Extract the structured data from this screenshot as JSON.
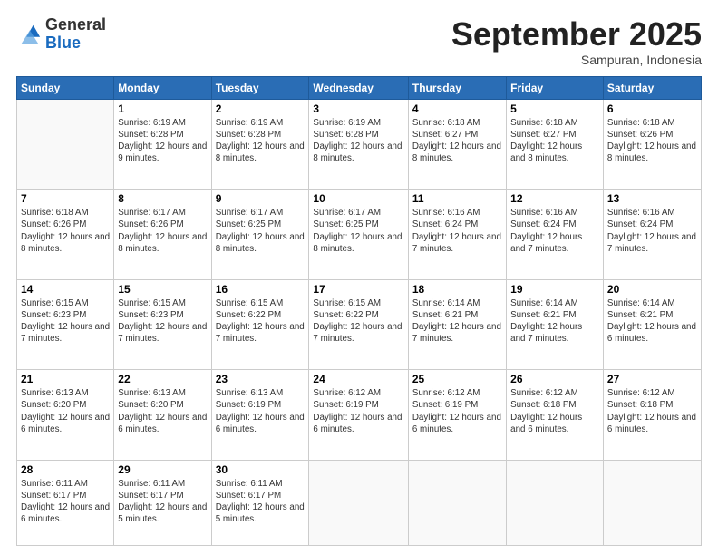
{
  "logo": {
    "general": "General",
    "blue": "Blue"
  },
  "title": "September 2025",
  "subtitle": "Sampuran, Indonesia",
  "days": [
    "Sunday",
    "Monday",
    "Tuesday",
    "Wednesday",
    "Thursday",
    "Friday",
    "Saturday"
  ],
  "weeks": [
    [
      {
        "num": "",
        "empty": true
      },
      {
        "num": "1",
        "sunrise": "6:19 AM",
        "sunset": "6:28 PM",
        "daylight": "12 hours and 9 minutes."
      },
      {
        "num": "2",
        "sunrise": "6:19 AM",
        "sunset": "6:28 PM",
        "daylight": "12 hours and 8 minutes."
      },
      {
        "num": "3",
        "sunrise": "6:19 AM",
        "sunset": "6:28 PM",
        "daylight": "12 hours and 8 minutes."
      },
      {
        "num": "4",
        "sunrise": "6:18 AM",
        "sunset": "6:27 PM",
        "daylight": "12 hours and 8 minutes."
      },
      {
        "num": "5",
        "sunrise": "6:18 AM",
        "sunset": "6:27 PM",
        "daylight": "12 hours and 8 minutes."
      },
      {
        "num": "6",
        "sunrise": "6:18 AM",
        "sunset": "6:26 PM",
        "daylight": "12 hours and 8 minutes."
      }
    ],
    [
      {
        "num": "7",
        "sunrise": "6:18 AM",
        "sunset": "6:26 PM",
        "daylight": "12 hours and 8 minutes."
      },
      {
        "num": "8",
        "sunrise": "6:17 AM",
        "sunset": "6:26 PM",
        "daylight": "12 hours and 8 minutes."
      },
      {
        "num": "9",
        "sunrise": "6:17 AM",
        "sunset": "6:25 PM",
        "daylight": "12 hours and 8 minutes."
      },
      {
        "num": "10",
        "sunrise": "6:17 AM",
        "sunset": "6:25 PM",
        "daylight": "12 hours and 8 minutes."
      },
      {
        "num": "11",
        "sunrise": "6:16 AM",
        "sunset": "6:24 PM",
        "daylight": "12 hours and 7 minutes."
      },
      {
        "num": "12",
        "sunrise": "6:16 AM",
        "sunset": "6:24 PM",
        "daylight": "12 hours and 7 minutes."
      },
      {
        "num": "13",
        "sunrise": "6:16 AM",
        "sunset": "6:24 PM",
        "daylight": "12 hours and 7 minutes."
      }
    ],
    [
      {
        "num": "14",
        "sunrise": "6:15 AM",
        "sunset": "6:23 PM",
        "daylight": "12 hours and 7 minutes."
      },
      {
        "num": "15",
        "sunrise": "6:15 AM",
        "sunset": "6:23 PM",
        "daylight": "12 hours and 7 minutes."
      },
      {
        "num": "16",
        "sunrise": "6:15 AM",
        "sunset": "6:22 PM",
        "daylight": "12 hours and 7 minutes."
      },
      {
        "num": "17",
        "sunrise": "6:15 AM",
        "sunset": "6:22 PM",
        "daylight": "12 hours and 7 minutes."
      },
      {
        "num": "18",
        "sunrise": "6:14 AM",
        "sunset": "6:21 PM",
        "daylight": "12 hours and 7 minutes."
      },
      {
        "num": "19",
        "sunrise": "6:14 AM",
        "sunset": "6:21 PM",
        "daylight": "12 hours and 7 minutes."
      },
      {
        "num": "20",
        "sunrise": "6:14 AM",
        "sunset": "6:21 PM",
        "daylight": "12 hours and 6 minutes."
      }
    ],
    [
      {
        "num": "21",
        "sunrise": "6:13 AM",
        "sunset": "6:20 PM",
        "daylight": "12 hours and 6 minutes."
      },
      {
        "num": "22",
        "sunrise": "6:13 AM",
        "sunset": "6:20 PM",
        "daylight": "12 hours and 6 minutes."
      },
      {
        "num": "23",
        "sunrise": "6:13 AM",
        "sunset": "6:19 PM",
        "daylight": "12 hours and 6 minutes."
      },
      {
        "num": "24",
        "sunrise": "6:12 AM",
        "sunset": "6:19 PM",
        "daylight": "12 hours and 6 minutes."
      },
      {
        "num": "25",
        "sunrise": "6:12 AM",
        "sunset": "6:19 PM",
        "daylight": "12 hours and 6 minutes."
      },
      {
        "num": "26",
        "sunrise": "6:12 AM",
        "sunset": "6:18 PM",
        "daylight": "12 hours and 6 minutes."
      },
      {
        "num": "27",
        "sunrise": "6:12 AM",
        "sunset": "6:18 PM",
        "daylight": "12 hours and 6 minutes."
      }
    ],
    [
      {
        "num": "28",
        "sunrise": "6:11 AM",
        "sunset": "6:17 PM",
        "daylight": "12 hours and 6 minutes."
      },
      {
        "num": "29",
        "sunrise": "6:11 AM",
        "sunset": "6:17 PM",
        "daylight": "12 hours and 5 minutes."
      },
      {
        "num": "30",
        "sunrise": "6:11 AM",
        "sunset": "6:17 PM",
        "daylight": "12 hours and 5 minutes."
      },
      {
        "num": "",
        "empty": true
      },
      {
        "num": "",
        "empty": true
      },
      {
        "num": "",
        "empty": true
      },
      {
        "num": "",
        "empty": true
      }
    ]
  ]
}
